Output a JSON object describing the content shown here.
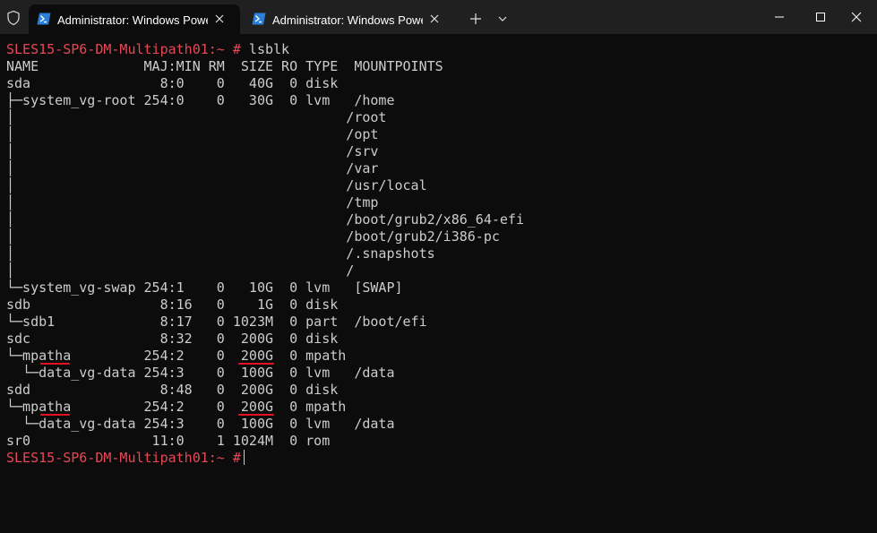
{
  "window": {
    "tabs": [
      {
        "title": "Administrator: Windows PowerShell",
        "active": true
      },
      {
        "title": "Administrator: Windows PowerShell",
        "active": false
      }
    ],
    "colors": {
      "titlebar": "#202020",
      "terminal_bg": "#0c0c0c",
      "text": "#cccccc",
      "prompt": "#e74856",
      "underline": "#e81123"
    }
  },
  "terminal": {
    "prompt": "SLES15-SP6-DM-Multipath01:~ #",
    "command": " lsblk",
    "header": "NAME             MAJ:MIN RM  SIZE RO TYPE  MOUNTPOINTS",
    "rows": [
      "sda                8:0    0   40G  0 disk",
      "├─system_vg-root 254:0    0   30G  0 lvm   /home",
      "│                                         /root",
      "│                                         /opt",
      "│                                         /srv",
      "│                                         /var",
      "│                                         /usr/local",
      "│                                         /tmp",
      "│                                         /boot/grub2/x86_64-efi",
      "│                                         /boot/grub2/i386-pc",
      "│                                         /.snapshots",
      "│                                         /",
      "└─system_vg-swap 254:1    0   10G  0 lvm   [SWAP]",
      "sdb                8:16   0    1G  0 disk",
      "└─sdb1             8:17   0 1023M  0 part  /boot/efi",
      "sdc                8:32   0  200G  0 disk",
      "└─mpatha         254:2    0  200G  0 mpath",
      "  └─data_vg-data 254:3    0  100G  0 lvm   /data",
      "sdd                8:48   0  200G  0 disk",
      "└─mpatha         254:2    0  200G  0 mpath",
      "  └─data_vg-data 254:3    0  100G  0 lvm   /data",
      "sr0               11:0    1 1024M  0 rom"
    ],
    "final_prompt": "SLES15-SP6-DM-Multipath01:~ #"
  }
}
